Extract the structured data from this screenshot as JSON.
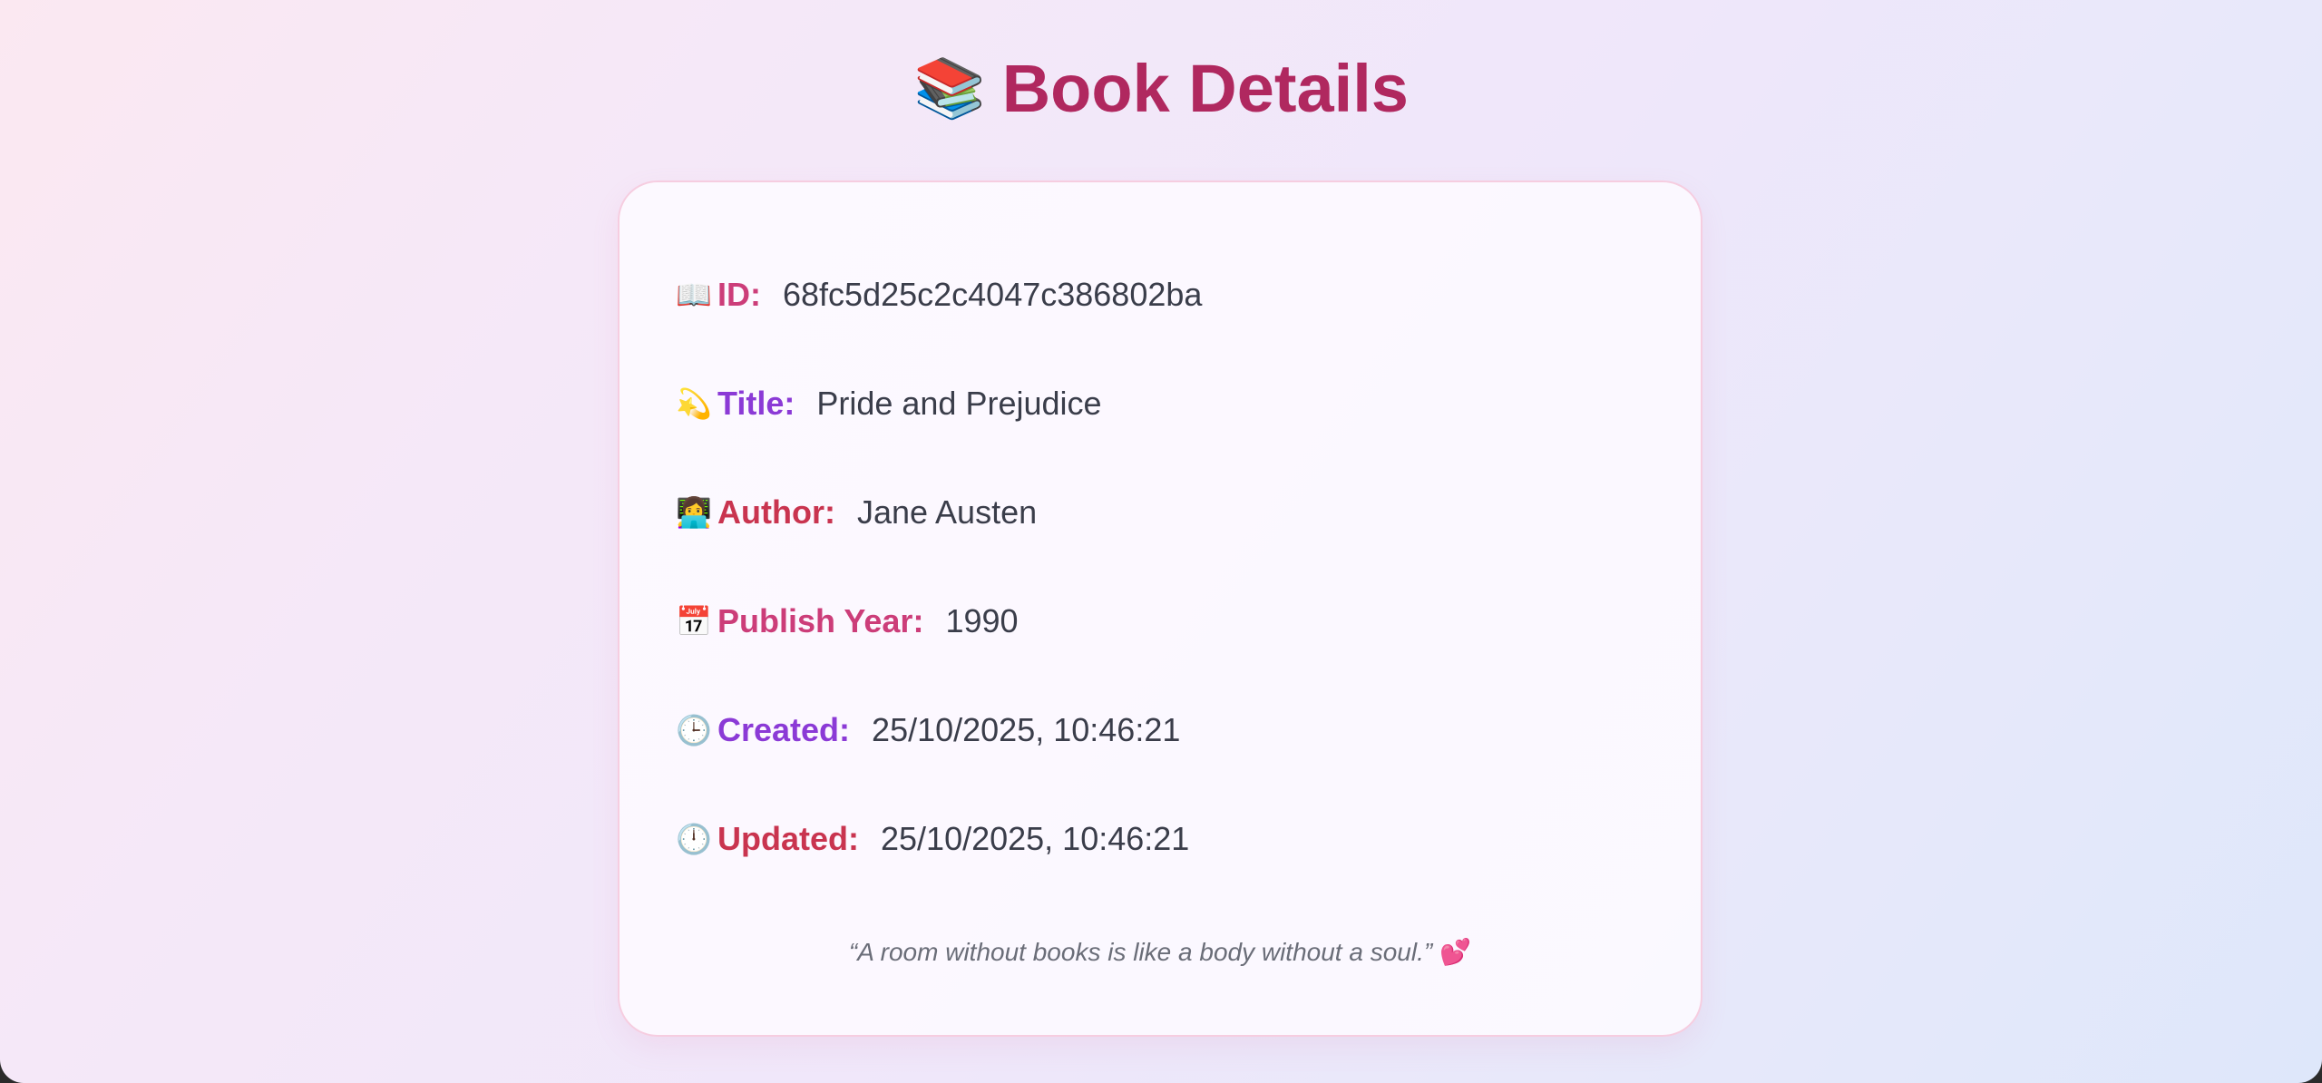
{
  "page": {
    "title": "Book Details",
    "title_icon": "📚"
  },
  "book": {
    "fields": [
      {
        "icon": "📖",
        "label": "ID:",
        "value": "68fc5d25c2c4047c386802ba",
        "color": "#cc3d79"
      },
      {
        "icon": "💫",
        "label": "Title:",
        "value": "Pride and Prejudice",
        "color": "#8b3ad6"
      },
      {
        "icon": "👩‍💻",
        "label": "Author:",
        "value": "Jane Austen",
        "color": "#c9344f"
      },
      {
        "icon": "📅",
        "label": "Publish Year:",
        "value": "1990",
        "color": "#cc3d79"
      },
      {
        "icon": "🕒",
        "label": "Created:",
        "value": "25/10/2025, 10:46:21",
        "color": "#8b3ad6"
      },
      {
        "icon": "🕛",
        "label": "Updated:",
        "value": "25/10/2025, 10:46:21",
        "color": "#c9344f"
      }
    ],
    "quote": "“A room without books is like a body without a soul.”",
    "quote_icon": "💕"
  },
  "colors": {
    "heading": "#b0285f",
    "card_border": "#f6cde0",
    "value_text": "#3a3d4a"
  }
}
